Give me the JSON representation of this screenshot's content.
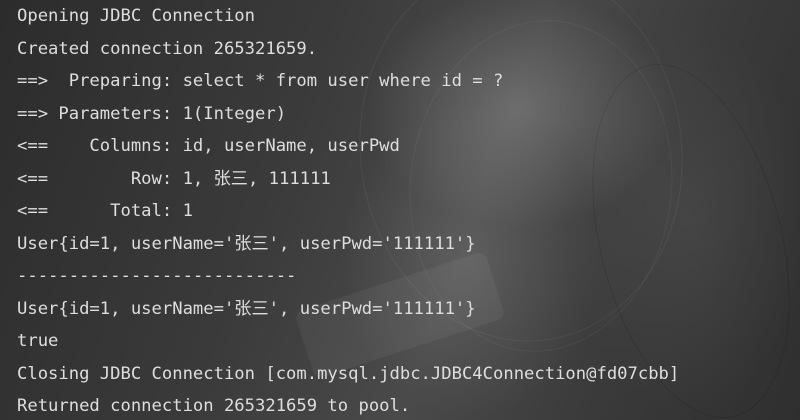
{
  "console": {
    "lines": [
      "Opening JDBC Connection",
      "Created connection 265321659.",
      "==>  Preparing: select * from user where id = ?",
      "==> Parameters: 1(Integer)",
      "<==    Columns: id, userName, userPwd",
      "<==        Row: 1, 张三, 111111",
      "<==      Total: 1",
      "User{id=1, userName='张三', userPwd='111111'}",
      "---------------------------",
      "User{id=1, userName='张三', userPwd='111111'}",
      "true",
      "Closing JDBC Connection [com.mysql.jdbc.JDBC4Connection@fd07cbb]",
      "Returned connection 265321659 to pool."
    ]
  },
  "colors": {
    "text": "#dedede",
    "background": "#2b2b2b"
  }
}
